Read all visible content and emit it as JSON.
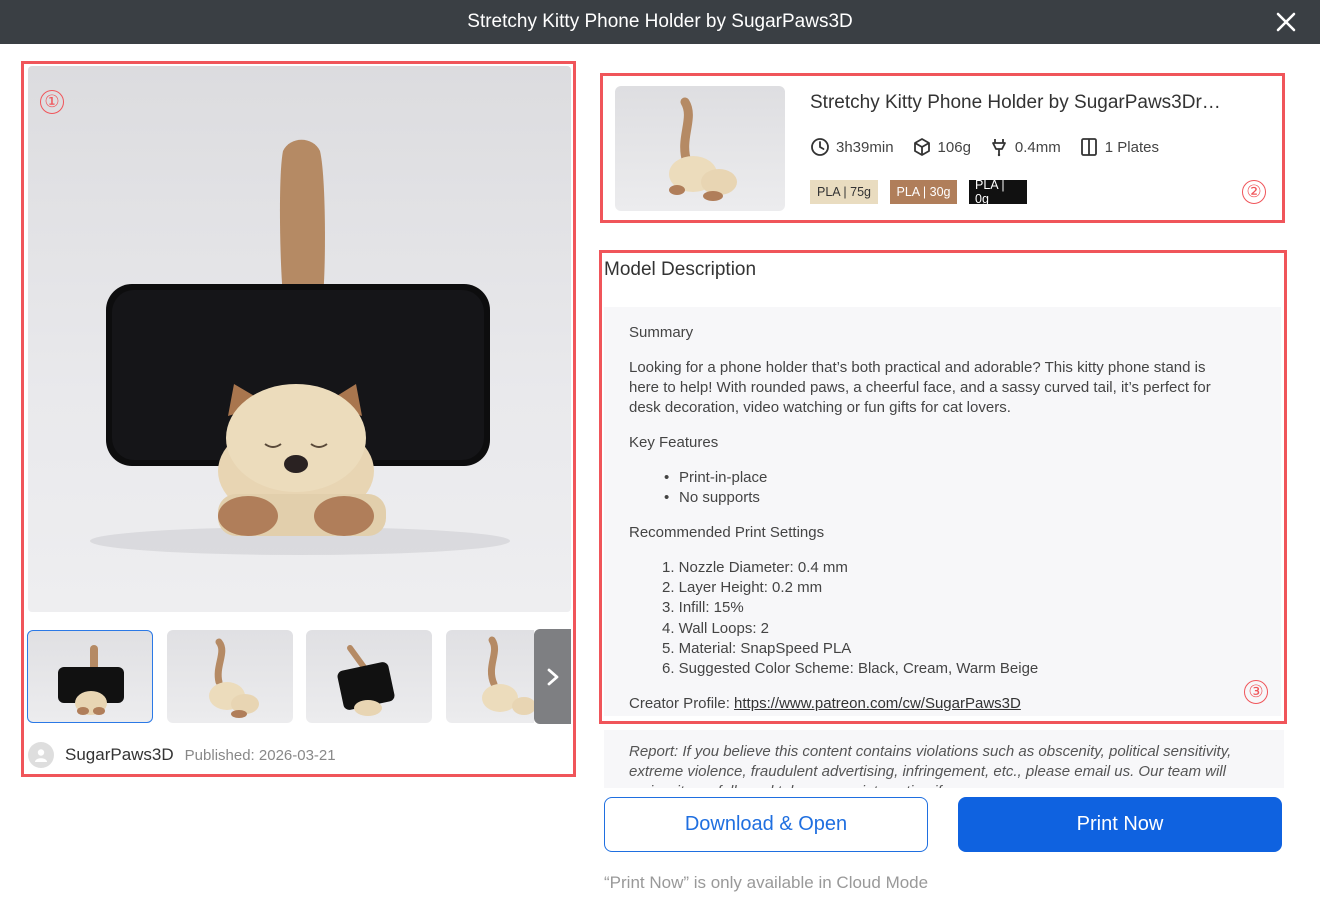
{
  "window": {
    "title": "Stretchy Kitty Phone Holder by SugarPaws3D"
  },
  "gallery": {
    "author": "SugarPaws3D",
    "published": "Published: 2026-03-21"
  },
  "card": {
    "title": "Stretchy Kitty Phone Holder by SugarPaws3Dr…",
    "time": "3h39min",
    "weight": "106g",
    "nozzle": "0.4mm",
    "plates": "1 Plates",
    "filaments": [
      {
        "label": "PLA | 75g",
        "color": "#e9dcc0",
        "text_color": "#333333"
      },
      {
        "label": "PLA | 30g",
        "color": "#b07e5a",
        "text_color": "#ffffff"
      },
      {
        "label": "PLA | 0g",
        "color": "#111111",
        "text_color": "#ffffff"
      }
    ]
  },
  "description": {
    "heading": "Model Description",
    "summary_heading": "Summary",
    "summary_lines": [
      "Looking for a phone holder that’s both practical and adorable? This kitty phone stand is",
      "here to help! With rounded paws, a cheerful face, and a sassy curved tail, it’s perfect for",
      "desk decoration, video watching or fun gifts for cat lovers."
    ],
    "features_heading": "Key Features",
    "features": [
      "Print-in-place",
      "No supports"
    ],
    "settings_heading": "Recommended Print Settings",
    "settings": [
      "1. Nozzle Diameter: 0.4 mm",
      "2. Layer Height: 0.2 mm",
      "3. Infill: 15%",
      "4. Wall Loops: 2",
      "5. Material: SnapSpeed PLA",
      "6. Suggested Color Scheme: Black, Cream, Warm Beige"
    ],
    "creator_label": "Creator Profile: ",
    "creator_link": "https://www.patreon.com/cw/SugarPaws3D"
  },
  "report": {
    "text": "Report: If you believe this content contains violations such as obscenity, political sensitivity, extreme violence, fraudulent advertising, infringement, etc., please email us. Our team will review it carefully and take appropriate action if necessary."
  },
  "actions": {
    "download_label": "Download & Open",
    "print_label": "Print Now",
    "note": "“Print Now” is only available in Cloud Mode"
  },
  "annotations": [
    "①",
    "②",
    "③"
  ],
  "colors": {
    "titlebar": "#3a3f44",
    "accent": "#0f62e0",
    "annotation": "#f0555a"
  }
}
